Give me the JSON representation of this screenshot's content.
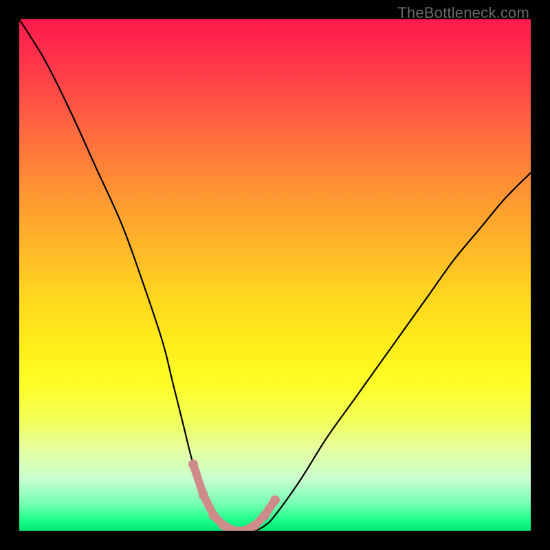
{
  "watermark": "TheBottleneck.com",
  "chart_data": {
    "type": "line",
    "title": "",
    "xlabel": "",
    "ylabel": "",
    "xlim": [
      0,
      100
    ],
    "ylim": [
      0,
      100
    ],
    "x": [
      0,
      5,
      10,
      15,
      20,
      24,
      28,
      30,
      32,
      34,
      36,
      38,
      40,
      42,
      44,
      46,
      48,
      50,
      55,
      60,
      65,
      70,
      75,
      80,
      85,
      90,
      95,
      100
    ],
    "values": [
      100,
      92,
      82,
      71,
      60,
      49,
      37,
      29,
      21,
      13,
      7,
      3,
      1,
      0,
      0,
      0,
      1,
      3,
      10,
      18,
      25,
      32,
      39,
      46,
      53,
      59,
      65,
      70
    ],
    "series": [
      {
        "name": "bottleneck-curve",
        "stroke": "#000000"
      },
      {
        "name": "marker-dots",
        "stroke": "#c77c7c"
      }
    ],
    "markers_x": [
      34,
      36,
      38,
      40,
      42,
      44,
      46,
      48,
      50
    ],
    "markers_y": [
      13,
      7,
      3,
      1,
      0,
      0,
      1,
      3,
      6
    ]
  }
}
